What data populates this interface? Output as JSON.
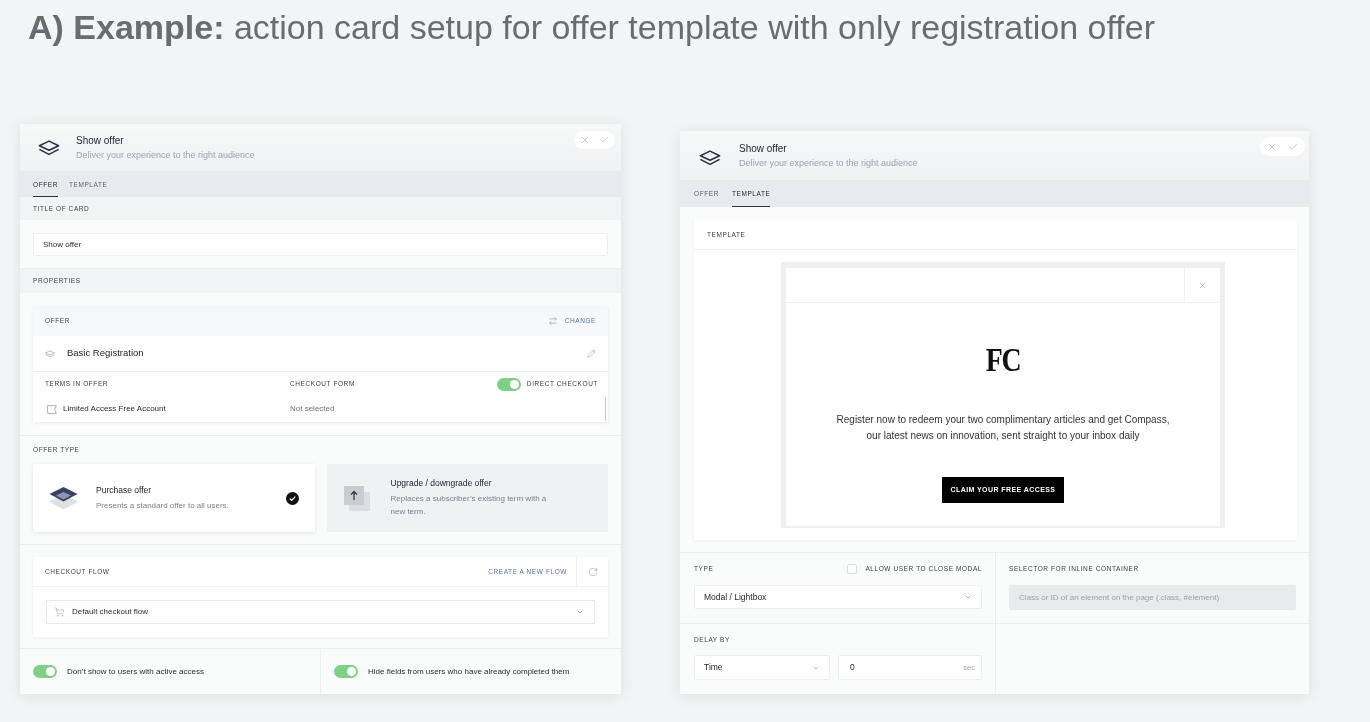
{
  "heading": "**A) Example:** action card setup for offer template with only registration offer",
  "offer_panel": {
    "header": {
      "title": "Show offer",
      "subtitle": "Deliver your experience to the right audience"
    },
    "tabs": [
      {
        "label": "OFFER",
        "selected": true
      },
      {
        "label": "TEMPLATE",
        "selected": false
      }
    ],
    "title_of_card": {
      "label": "TITLE OF CARD",
      "value": "Show offer"
    },
    "properties": {
      "label": "PROPERTIES",
      "offer": {
        "label": "OFFER",
        "change_link": "CHANGE",
        "name": "Basic Registration",
        "terms_column": "TERMS IN OFFER",
        "checkout_form_column": "CHECKOUT FORM",
        "direct_checkout": {
          "label": "DIRECT CHECKOUT",
          "on": true
        },
        "terms": [
          {
            "name": "Limited Access Free Account",
            "checkout_form": "Not selected"
          }
        ]
      }
    },
    "offer_type": {
      "label": "OFFER TYPE",
      "options": [
        {
          "kind": "purchase",
          "title": "Purchase offer",
          "description": "Presents a standard offer to all users.",
          "selected": true
        },
        {
          "kind": "upgrade",
          "title": "Upgrade / downgrade offer",
          "description": "Replaces a subscriber’s existing term with a new term.",
          "selected": false
        }
      ]
    },
    "checkout_flow": {
      "label": "CHECKOUT FLOW",
      "create_link": "CREATE A NEW FLOW",
      "value": "Default checkout flow"
    },
    "toggles": [
      {
        "label": "Don’t show to users with active access",
        "on": true
      },
      {
        "label": "Hide fields from users who have already completed them",
        "on": true
      }
    ]
  },
  "template_panel": {
    "header": {
      "title": "Show offer",
      "subtitle": "Deliver your experience to the right audience"
    },
    "tabs": [
      {
        "label": "OFFER",
        "selected": false
      },
      {
        "label": "TEMPLATE",
        "selected": true
      }
    ],
    "template": {
      "label": "TEMPLATE",
      "preview": {
        "logo": "FC",
        "message": "Register now to redeem your two complimentary articles and get Compass,\nour latest news on innovation, sent straight to your inbox daily",
        "button": "CLAIM YOUR FREE ACCESS"
      }
    },
    "type": {
      "label": "TYPE",
      "value": "Modal / Lightbox"
    },
    "allow_close": {
      "label": "ALLOW USER TO CLOSE MODAL",
      "checked": false
    },
    "selector": {
      "label": "SELECTOR FOR INLINE CONTAINER",
      "placeholder": "Class or ID of an element on the page (.class, #element)",
      "disabled": true
    },
    "delay": {
      "label": "DELAY BY",
      "mode": "Time",
      "value": "0",
      "unit": "sec"
    }
  }
}
